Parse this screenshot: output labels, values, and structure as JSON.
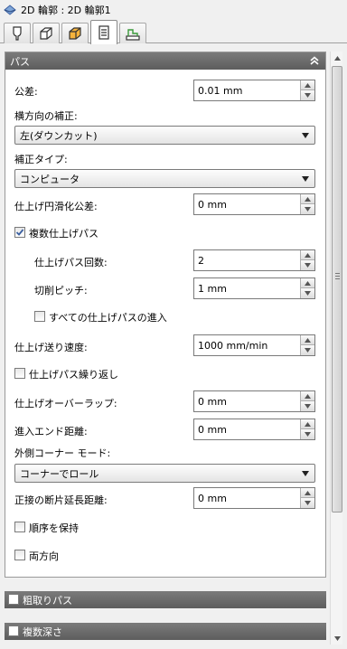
{
  "window": {
    "title": "2D 輪郭 : 2D 輪郭1"
  },
  "tabs": [
    {
      "icon": "tool-icon"
    },
    {
      "icon": "holder-icon"
    },
    {
      "icon": "geometry-icon"
    },
    {
      "icon": "passes-icon",
      "active": true
    },
    {
      "icon": "linking-icon"
    }
  ],
  "passes": {
    "header": "パス",
    "tolerance": {
      "label": "公差:",
      "value": "0.01 mm"
    },
    "compensation": {
      "label": "横方向の補正:",
      "value": "左(ダウンカット)"
    },
    "compensation_type": {
      "label": "補正タイプ:",
      "value": "コンピュータ"
    },
    "smoothing_tolerance": {
      "label": "仕上げ円滑化公差:",
      "value": "0 mm"
    },
    "multiple_finishing": {
      "label": "複数仕上げパス",
      "checked": true
    },
    "finishing_passes_count": {
      "label": "仕上げパス回数:",
      "value": "2"
    },
    "stepover": {
      "label": "切削ピッチ:",
      "value": "1 mm"
    },
    "lead_all_passes": {
      "label": "すべての仕上げパスの進入",
      "checked": false
    },
    "finishing_feedrate": {
      "label": "仕上げ送り速度:",
      "value": "1000 mm/min"
    },
    "repeat_finishing": {
      "label": "仕上げパス繰り返し",
      "checked": false
    },
    "finishing_overlap": {
      "label": "仕上げオーバーラップ:",
      "value": "0 mm"
    },
    "lead_end_distance": {
      "label": "進入エンド距離:",
      "value": "0 mm"
    },
    "outer_corner_mode": {
      "label": "外側コーナー モード:",
      "value": "コーナーでロール"
    },
    "tangential_extension": {
      "label": "正接の断片延長距離:",
      "value": "0 mm"
    },
    "keep_order": {
      "label": "順序を保持",
      "checked": false
    },
    "both_ways": {
      "label": "両方向",
      "checked": false
    }
  },
  "sections": {
    "roughing": {
      "label": "粗取りパス",
      "checked": false
    },
    "multiple_depths": {
      "label": "複数深さ",
      "checked": false
    }
  },
  "colors": {
    "header": "#666666",
    "checkmark": "#3a5fa0"
  }
}
